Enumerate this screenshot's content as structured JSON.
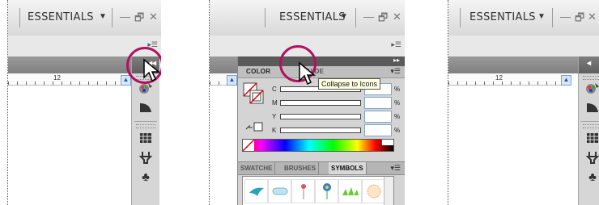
{
  "shots": [
    {
      "workspace_label": "ESSENTIALS",
      "workspace_arrow": "▼",
      "minimize": "—",
      "restore": "🗗",
      "close": "✕",
      "strip_menu": "▸☰",
      "dock_collapse": "◂◂",
      "ruler_number": "12",
      "scroll_up": "▲"
    },
    {
      "workspace_label": "ESSENTIALS",
      "workspace_arrow": "▼",
      "minimize": "—",
      "restore": "🗗",
      "close": "✕",
      "strip_menu": "▸☰",
      "dock_expand": "▸▸",
      "scroll_up": "▲",
      "color_panel": {
        "tab_color": "COLOR",
        "tab_guide": "COLOR GUIDE",
        "tab_guide_visible": "UIDE",
        "menu": "▾☰",
        "sliders": [
          {
            "label": "C",
            "pct": "%"
          },
          {
            "label": "M",
            "pct": "%"
          },
          {
            "label": "Y",
            "pct": "%"
          },
          {
            "label": "K",
            "pct": "%"
          }
        ],
        "swatch_tabs": [
          "SWATCHES",
          "BRUSHES",
          "SYMBOLS"
        ],
        "swatch_tabs_visible": [
          "SWATCHE",
          "BRUSHES",
          "SYMBOLS"
        ],
        "swatch_menu": "▾☰"
      },
      "tooltip": "Collapse to Icons"
    },
    {
      "workspace_label": "ESSENTIALS",
      "workspace_arrow": "▼",
      "minimize": "—",
      "restore": "🗗",
      "close": "✕",
      "strip_menu": "▸☰",
      "dock_collapse": "◂",
      "ruler_number": "12",
      "scroll_up": "▲"
    }
  ],
  "dock_icons": [
    "color-wheel-icon",
    "gradient-icon",
    "swatch-grid-icon",
    "brush-icon",
    "club-symbol-icon"
  ],
  "colors": {
    "highlight_ring": "#b0135e",
    "panel_bg": "#d4d4d4",
    "dock_head": "#6a6a6a"
  }
}
